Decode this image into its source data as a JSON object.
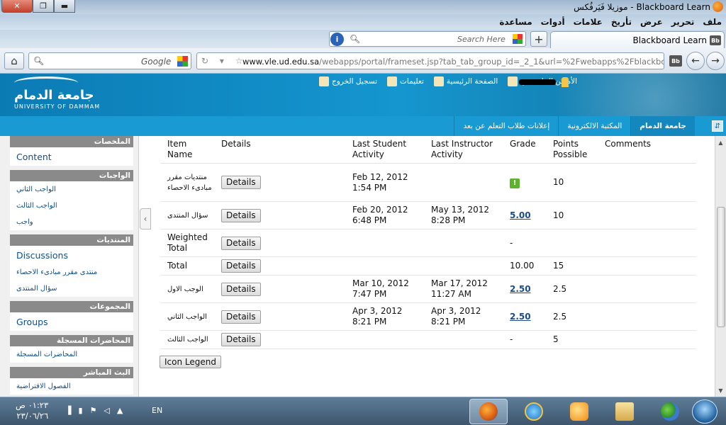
{
  "window": {
    "title": "Blackboard Learn - موزيلا فَيَرفُكس",
    "buttons": {
      "close": "✕",
      "restore": "❐",
      "minimize": "▬"
    }
  },
  "menubar": [
    "ملف",
    "تحرير",
    "عرض",
    "تأريخ",
    "علامات",
    "أدوات",
    "مساعدة"
  ],
  "tabstrip": {
    "search_placeholder": "Search Here",
    "newtab": "+",
    "tab_label": "Blackboard Learn",
    "tab_icon": "Bb"
  },
  "navbar": {
    "google_placeholder": "Google",
    "url_host": "www.vle.ud.edu.sa",
    "url_path": "/webapps/portal/frameset.jsp?tab_tab_group_id=_2_1&url=%2Fwebapps%2Fblackboard%2Fe",
    "fav_icon": "Bb"
  },
  "header": {
    "logo_ar": "جامعة الدمام",
    "logo_en": "UNIVERSITY OF DAMMAM",
    "links": [
      "الأماكن الخاصة بي",
      "الصفحة الرئيسية",
      "تعليمات",
      "تسجيل الخروج"
    ]
  },
  "bbtabs": [
    "جامعة الدمام",
    "المكتبة الالكترونية",
    "إعلانات طلاب التعلم عن بعد"
  ],
  "course_menu": [
    {
      "heading": "الملخصات",
      "items": [
        {
          "label": "Content",
          "ar": false
        }
      ]
    },
    {
      "heading": "الواجبات",
      "items": [
        {
          "label": "الواجب الثاني",
          "ar": true
        },
        {
          "label": "الواجب الثالث",
          "ar": true
        },
        {
          "label": "واجب",
          "ar": true
        }
      ]
    },
    {
      "heading": "المنتديات",
      "items": [
        {
          "label": "Discussions",
          "ar": false
        },
        {
          "label": "منتدى مقرر مبادىء الاحصاء",
          "ar": true
        },
        {
          "label": "سؤال المنتدى",
          "ar": true
        }
      ]
    },
    {
      "heading": "المجموعات",
      "items": [
        {
          "label": "Groups",
          "ar": false
        }
      ]
    },
    {
      "heading": "المحاضرات المسجلة",
      "items": [
        {
          "label": "المحاضرات المسجلة",
          "ar": true
        }
      ]
    },
    {
      "heading": "البث المباشر",
      "items": [
        {
          "label": "الفصول الافتراضية",
          "ar": true
        }
      ]
    }
  ],
  "grades": {
    "columns": [
      "Item Name",
      "Details",
      "Last Student Activity",
      "Last Instructor Activity",
      "Grade",
      "Points Possible",
      "Comments"
    ],
    "rows": [
      {
        "name": "منتديات مقرر مبادىء الاحصاء",
        "name_ar": true,
        "details": "Details",
        "student": "Feb 12, 2012 1:54 PM",
        "instructor": "",
        "grade": "!",
        "grade_type": "icon",
        "points": "10"
      },
      {
        "name": "سؤال المنتدى",
        "name_ar": true,
        "details": "Details",
        "student": "Feb 20, 2012 6:48 PM",
        "instructor": "May 13, 2012 8:28 PM",
        "grade": "5.00",
        "grade_type": "link",
        "points": "10"
      },
      {
        "name": "Weighted Total",
        "name_ar": false,
        "details": "Details",
        "student": "",
        "instructor": "",
        "grade": "-",
        "grade_type": "text",
        "points": ""
      },
      {
        "name": "Total",
        "name_ar": false,
        "details": "Details",
        "student": "",
        "instructor": "",
        "grade": "10.00",
        "grade_type": "text",
        "points": "15"
      },
      {
        "name": "الوجب الاول",
        "name_ar": true,
        "details": "Details",
        "student": "Mar 10, 2012 7:47 PM",
        "instructor": "Mar 17, 2012 11:27 AM",
        "grade": "2.50",
        "grade_type": "link",
        "points": "2.5"
      },
      {
        "name": "الواجب الثاني",
        "name_ar": true,
        "details": "Details",
        "student": "Apr 3, 2012 8:21 PM",
        "instructor": "Apr 3, 2012 8:21 PM",
        "grade": "2.50",
        "grade_type": "link",
        "points": "2.5"
      },
      {
        "name": "الواجب الثالث",
        "name_ar": true,
        "details": "Details",
        "student": "",
        "instructor": "",
        "grade": "-",
        "grade_type": "text",
        "points": "5"
      }
    ],
    "legend_button": "Icon Legend"
  },
  "taskbar": {
    "time": "٠١:٢٣ ص",
    "date": "٢٣/٠٦/٢٦",
    "lang": "EN"
  },
  "colors": {
    "header_blue": "#1596cf",
    "link_blue": "#1a4c8c",
    "menu_heading_gray": "#8a8a8a",
    "needs_grading_green": "#5cb32c"
  }
}
